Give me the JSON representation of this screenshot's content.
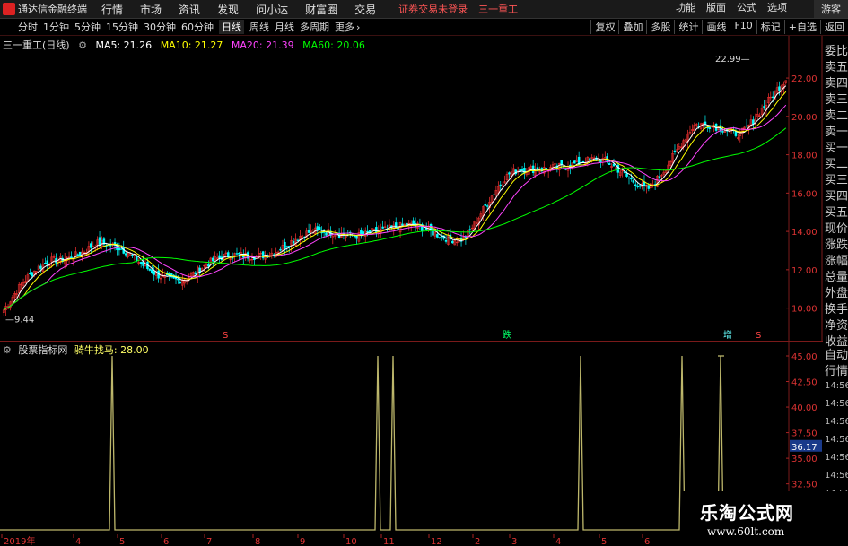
{
  "menubar": {
    "app_title": "通达信金融终端",
    "items": [
      "行情",
      "市场",
      "资讯",
      "发现",
      "问小达",
      "财富圈",
      "交易"
    ],
    "status": "证券交易未登录",
    "stock": "三一重工",
    "right": [
      "功能",
      "版面",
      "公式",
      "选项"
    ],
    "guest": "游客"
  },
  "toolbar": {
    "periods": [
      "分时",
      "1分钟",
      "5分钟",
      "15分钟",
      "30分钟",
      "60分钟",
      "日线",
      "周线",
      "月线",
      "多周期",
      "更多"
    ],
    "active_period": "日线",
    "tools": [
      "复权",
      "叠加",
      "多股",
      "统计",
      "画线",
      "F10",
      "标记",
      "+自选",
      "返回"
    ]
  },
  "main_chart": {
    "stock_label": "三一重工(日线)",
    "ma": [
      {
        "label": "MA5: 21.26",
        "color": "#ffffff"
      },
      {
        "label": "MA10: 21.27",
        "color": "#ffff00"
      },
      {
        "label": "MA20: 21.39",
        "color": "#ff44ff"
      },
      {
        "label": "MA60: 20.06",
        "color": "#00ff00"
      }
    ],
    "high_label": "22.99",
    "low_label": "9.44",
    "yaxis": [
      "22.00",
      "20.00",
      "18.00",
      "16.00",
      "14.00",
      "12.00",
      "10.00"
    ],
    "markers": [
      "S",
      "跌",
      "增",
      "S"
    ]
  },
  "indicator": {
    "source": "股票指标网",
    "name": "骑牛找马: 28.00",
    "yaxis": [
      "45.00",
      "42.50",
      "40.00",
      "37.50",
      "36.17",
      "35.00",
      "32.50"
    ],
    "current": "36.17"
  },
  "side_panel": {
    "labels": [
      "委比",
      "卖五",
      "卖四",
      "卖三",
      "卖二",
      "卖一",
      "买一",
      "买二",
      "买三",
      "买四",
      "买五",
      "现价",
      "涨跌",
      "涨幅",
      "总量",
      "外盘",
      "换手",
      "净资",
      "收益",
      "自动",
      "行情"
    ],
    "times": [
      "14:56",
      "14:56",
      "14:56",
      "14:56",
      "14:56",
      "14:56",
      "14:56",
      "14:56"
    ]
  },
  "date_axis": [
    "2019年",
    "4",
    "5",
    "6",
    "7",
    "8",
    "9",
    "10",
    "11",
    "12",
    "2",
    "3",
    "4",
    "5",
    "6"
  ],
  "watermark": {
    "title": "乐淘公式网",
    "url": "www.60lt.com"
  },
  "colors": {
    "up": "#ff3333",
    "down": "#00ffff",
    "ma5": "#ffffff",
    "ma10": "#ffff00",
    "ma20": "#ff44ff",
    "ma60": "#00ff00",
    "indicator": "#bdb76b"
  },
  "chart_data": [
    {
      "type": "candlestick",
      "title": "三一重工(日线)",
      "x_range": [
        "2019-01",
        "2020-06"
      ],
      "ylim": [
        9.0,
        23.5
      ],
      "monthly_close": [
        [
          "2019-01",
          9.9
        ],
        [
          "2019-02",
          12.0
        ],
        [
          "2019-03",
          13.2
        ],
        [
          "2019-04",
          12.4
        ],
        [
          "2019-05",
          12.2
        ],
        [
          "2019-06",
          12.6
        ],
        [
          "2019-07",
          12.9
        ],
        [
          "2019-08",
          13.4
        ],
        [
          "2019-09",
          14.5
        ],
        [
          "2019-10",
          14.4
        ],
        [
          "2019-11",
          14.0
        ],
        [
          "2019-12",
          16.3
        ],
        [
          "2020-01",
          17.4
        ],
        [
          "2020-02",
          17.6
        ],
        [
          "2020-03",
          17.0
        ],
        [
          "2020-04",
          19.3
        ],
        [
          "2020-05",
          19.0
        ],
        [
          "2020-06",
          21.3
        ]
      ],
      "series": [
        {
          "name": "MA5",
          "last": 21.26
        },
        {
          "name": "MA10",
          "last": 21.27
        },
        {
          "name": "MA20",
          "last": 21.39
        },
        {
          "name": "MA60",
          "last": 20.06
        }
      ],
      "high": 22.99,
      "low": 9.44
    },
    {
      "type": "line",
      "title": "骑牛找马",
      "ylim": [
        28.0,
        45.0
      ],
      "baseline": 28.0,
      "spike_value": 45.0,
      "spike_months": [
        "2019-05",
        "2019-11",
        "2019-11",
        "2020-03",
        "2020-06",
        "2020-06"
      ]
    }
  ]
}
